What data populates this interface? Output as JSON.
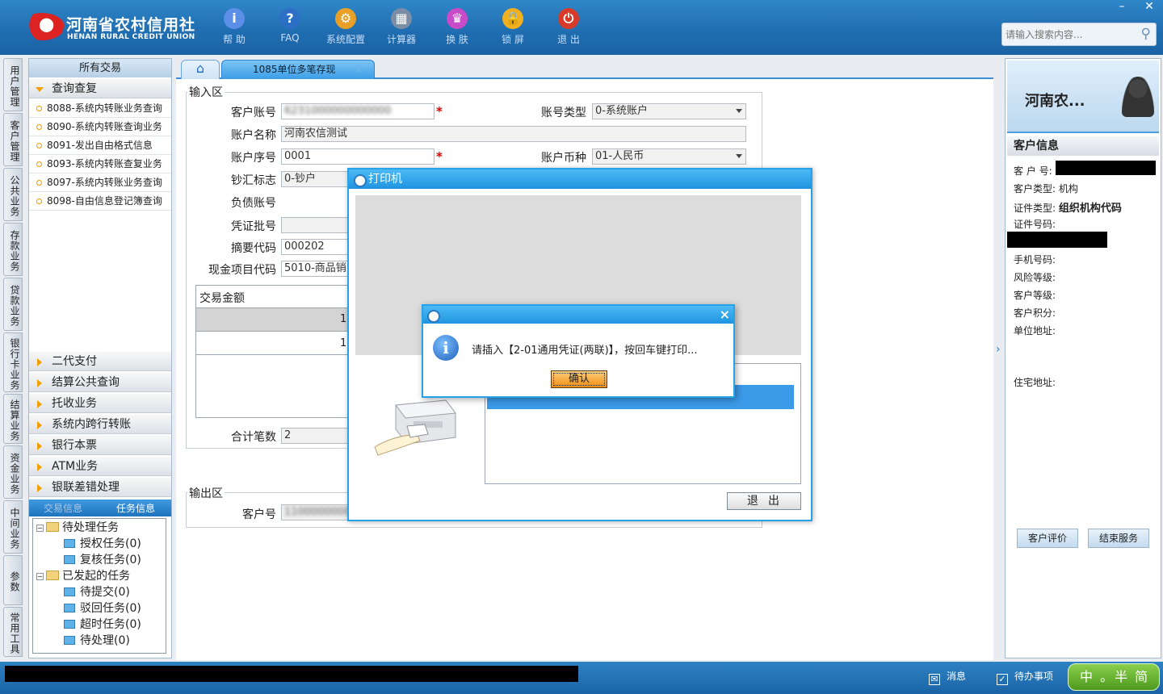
{
  "header": {
    "logo_cn": "河南省农村信用社",
    "logo_en": "HENAN RURAL CREDIT UNION",
    "toolbar": [
      {
        "label": "帮 助",
        "icon": "info-icon",
        "glyph": "i",
        "color": "#5b8ee6"
      },
      {
        "label": "FAQ",
        "icon": "question-icon",
        "glyph": "?",
        "color": "#2d6fc4"
      },
      {
        "label": "系统配置",
        "icon": "toolbox-icon",
        "glyph": "⚙",
        "color": "#e8a028"
      },
      {
        "label": "计算器",
        "icon": "calculator-icon",
        "glyph": "▦",
        "color": "#7c8ea6"
      },
      {
        "label": "换 肤",
        "icon": "shirt-icon",
        "glyph": "♛",
        "color": "#c84cc8"
      },
      {
        "label": "锁 屏",
        "icon": "lock-icon",
        "glyph": "🔒",
        "color": "#f0b020"
      },
      {
        "label": "退 出",
        "icon": "power-icon",
        "glyph": "⏻",
        "color": "#d83a2a"
      }
    ],
    "search_placeholder": "请输入搜索内容...",
    "minimize": "–",
    "close": "✕"
  },
  "vertical_tabs": [
    "用户管理",
    "客户管理",
    "公共业务",
    "存款业务",
    "贷款业务",
    "银行卡业务",
    "结算业务",
    "资金业务",
    "中间业务",
    "参数",
    "常用工具"
  ],
  "left_panel": {
    "title": "所有交易",
    "open_group": "查询查复",
    "sub_items": [
      "8088-系统内转账业务查询",
      "8090-系统内转账查询业务",
      "8091-发出自由格式信息",
      "8093-系统内转账查复业务",
      "8097-系统内转账业务查询",
      "8098-自由信息登记簿查询"
    ],
    "groups": [
      "二代支付",
      "结算公共查询",
      "托收业务",
      "系统内跨行转账",
      "银行本票",
      "ATM业务",
      "银联差错处理"
    ],
    "task_tabs": [
      "交易信息",
      "任务信息"
    ],
    "tree": [
      {
        "label": "待处理任务",
        "type": "folder"
      },
      {
        "label": "授权任务(0)",
        "type": "leaf"
      },
      {
        "label": "复核任务(0)",
        "type": "leaf"
      },
      {
        "label": "已发起的任务",
        "type": "folder"
      },
      {
        "label": "待提交(0)",
        "type": "leaf"
      },
      {
        "label": "驳回任务(0)",
        "type": "leaf"
      },
      {
        "label": "超时任务(0)",
        "type": "leaf"
      },
      {
        "label": "待处理(0)",
        "type": "leaf"
      }
    ]
  },
  "tabs": {
    "home_glyph": "⌂",
    "active": "1085单位多笔存现",
    "close": "×"
  },
  "form": {
    "input_area": "输入区",
    "output_area": "输出区",
    "labels": {
      "account": "客户账号",
      "account_type": "账号类型",
      "account_name": "账户名称",
      "seq": "账户序号",
      "currency": "账户币种",
      "cash_flag": "钞汇标志",
      "debt_account": "负债账号",
      "voucher_batch": "凭证批号",
      "summary_code": "摘要代码",
      "cash_item": "现金项目代码",
      "total_count": "合计笔数",
      "out_account": "客户号"
    },
    "values": {
      "account": "6231000000000000",
      "account_type": "0-系统账户",
      "account_name": "河南农信测试",
      "seq": "0001",
      "currency": "01-人民币",
      "cash_flag": "0-钞户",
      "summary_code": "000202",
      "cash_item": "5010-商品销",
      "total_count": "2",
      "out_account": "1100000000"
    },
    "table_header": "交易金额",
    "table_rows": [
      "11",
      "11"
    ],
    "required_mark": "*"
  },
  "right_panel": {
    "name": "河南农...",
    "info_title": "客户信息",
    "fields": {
      "cust_no": "客 户 号:",
      "cust_type": "客户类型:",
      "cust_type_val": "机构",
      "id_type": "证件类型:",
      "id_type_val": "组织机构代码",
      "id_no": "证件号码:",
      "phone": "手机号码:",
      "risk": "风险等级:",
      "level": "客户等级:",
      "points": "客户积分:",
      "work_addr": "单位地址:",
      "home_addr": "住宅地址:"
    },
    "btn_eval": "客户评价",
    "btn_end": "结束服务"
  },
  "printer_dialog": {
    "title": "打印机",
    "exit_label": "退出"
  },
  "message_dialog": {
    "text": "请插入【2-01通用凭证(两联)】，按回车键打印...",
    "ok_label": "确认",
    "close": "×"
  },
  "statusbar": {
    "messages": "消息",
    "todo": "待办事项",
    "ime": "中 。半 简"
  }
}
